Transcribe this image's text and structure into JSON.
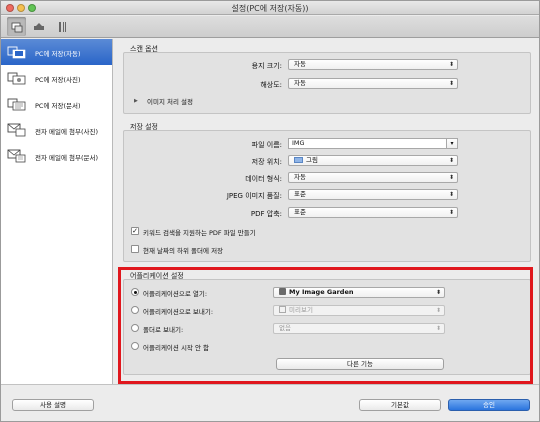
{
  "window": {
    "title": "설정(PC에 저장(자동))"
  },
  "sidebar": {
    "items": [
      {
        "label": "PC에 저장(자동)",
        "icon": "save-to-pc-icon",
        "selected": true
      },
      {
        "label": "PC에 저장(사진)",
        "icon": "save-photo-icon",
        "selected": false
      },
      {
        "label": "PC에 저장(문서)",
        "icon": "save-document-icon",
        "selected": false
      },
      {
        "label": "전자 메일에 첨부(사진)",
        "icon": "email-photo-icon",
        "selected": false
      },
      {
        "label": "전자 메일에 첨부(문서)",
        "icon": "email-document-icon",
        "selected": false
      }
    ]
  },
  "scan_options": {
    "title": "스캔 옵션",
    "paper_size_label": "용지 크기:",
    "paper_size_value": "자동",
    "resolution_label": "해상도:",
    "resolution_value": "자동",
    "image_processing_label": "이미지 처리 설정"
  },
  "save_settings": {
    "title": "저장 설정",
    "file_name_label": "파일 이름:",
    "file_name_value": "IMG",
    "save_in_label": "저장 위치:",
    "save_in_value": "그림",
    "data_format_label": "데이터 형식:",
    "data_format_value": "자동",
    "jpeg_quality_label": "JPEG 이미지 품질:",
    "jpeg_quality_value": "표준",
    "pdf_compression_label": "PDF 압축:",
    "pdf_compression_value": "표준",
    "keyword_checkbox_label": "키워드 검색을 지원하는 PDF 파일 만들기",
    "keyword_checked": true,
    "subfolder_checkbox_label": "현재 날짜의 하위 폴더에 저장",
    "subfolder_checked": false
  },
  "app_settings": {
    "title": "어플리케이션 설정",
    "open_with_label": "어플리케이션으로 열기:",
    "open_with_value": "My Image Garden",
    "send_to_app_label": "어플리케이션으로 보내기:",
    "send_to_app_value": "미리보기",
    "send_to_folder_label": "폴더로 보내기:",
    "send_to_folder_value": "없음",
    "do_not_start_label": "어플리케이션 시작 안 함",
    "more_functions_label": "다른 기능",
    "selected_option": "open_with"
  },
  "footer": {
    "instructions_label": "사용 설명",
    "defaults_label": "기본값",
    "ok_label": "승인"
  },
  "colors": {
    "highlight": "#e0171d",
    "selection": "#2a65c8",
    "default_button": "#2a74de"
  }
}
